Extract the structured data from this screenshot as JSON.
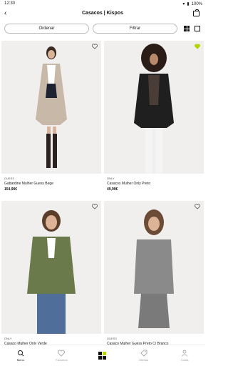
{
  "status": {
    "time": "12:30",
    "battery": "100%"
  },
  "header": {
    "title": "Casacos | Kispos"
  },
  "toolbar": {
    "order_label": "Ordenar",
    "filter_label": "Filtrar"
  },
  "products": [
    {
      "brand": "GUESS",
      "name": "Gabardine Mulher Guess Bege",
      "price": "154,90€",
      "favorited": false
    },
    {
      "brand": "ONLY",
      "name": "Casacos Mulher Only Preto",
      "price": "49,99€",
      "favorited": true
    },
    {
      "brand": "ONLY",
      "name": "Casaco Mulher Only Verde",
      "price": "",
      "favorited": false
    },
    {
      "brand": "GUESS",
      "name": "Casaco Mulher Guess Preto C/ Branco",
      "price": "",
      "favorited": false
    }
  ],
  "nav": {
    "items": [
      {
        "label": "Menu",
        "icon": "search-icon"
      },
      {
        "label": "Favoritos",
        "icon": "heart-icon"
      },
      {
        "label": "",
        "icon": "brand-logo"
      },
      {
        "label": "Ofertas",
        "icon": "tag-icon"
      },
      {
        "label": "Conta",
        "icon": "person-icon"
      }
    ]
  },
  "colors": {
    "accent": "#b6d400"
  }
}
